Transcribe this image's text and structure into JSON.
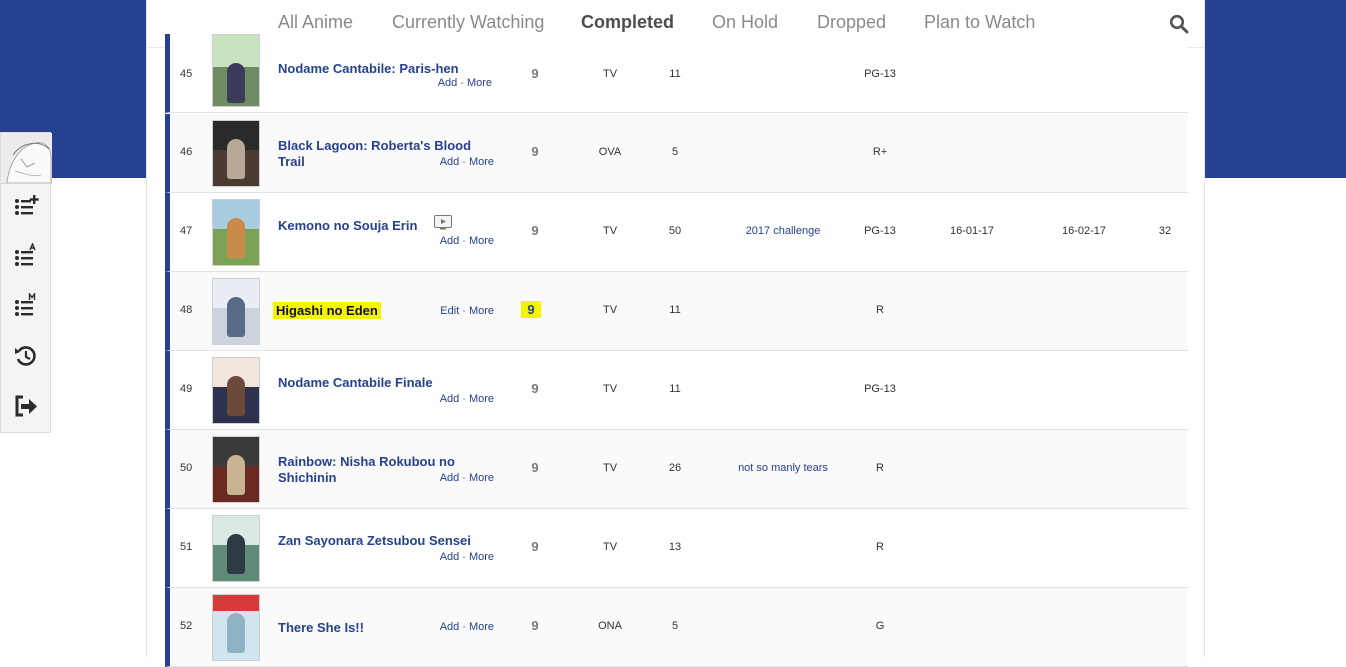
{
  "tabs": [
    {
      "label": "All Anime"
    },
    {
      "label": "Currently Watching"
    },
    {
      "label": "Completed",
      "active": true
    },
    {
      "label": "On Hold"
    },
    {
      "label": "Dropped"
    },
    {
      "label": "Plan to Watch"
    }
  ],
  "icons": {
    "search": "search-icon",
    "sidebar": [
      "add-list-icon",
      "list-anime-icon",
      "list-manga-icon",
      "history-icon",
      "logout-icon"
    ]
  },
  "colors": {
    "accent": "#26418f",
    "highlight": "#f5f500"
  },
  "rows": [
    {
      "num": "45",
      "title": "Nodame Cantabile: Paris-hen",
      "action": "Add",
      "more": "More",
      "score": "9",
      "type": "TV",
      "eps": "11",
      "tags": "",
      "rating": "PG-13",
      "start": "",
      "finish": "",
      "days": ""
    },
    {
      "num": "46",
      "title": "Black Lagoon: Roberta's Blood Trail",
      "action": "Add",
      "more": "More",
      "score": "9",
      "type": "OVA",
      "eps": "5",
      "tags": "",
      "rating": "R+",
      "start": "",
      "finish": "",
      "days": ""
    },
    {
      "num": "47",
      "title": "Kemono no Souja Erin",
      "action": "Add",
      "more": "More",
      "score": "9",
      "type": "TV",
      "eps": "50",
      "tags": "2017 challenge",
      "rating": "PG-13",
      "start": "16-01-17",
      "finish": "16-02-17",
      "days": "32"
    },
    {
      "num": "48",
      "title": "Higashi no Eden",
      "action": "Edit",
      "more": "More",
      "score": "9",
      "type": "TV",
      "eps": "11",
      "tags": "",
      "rating": "R",
      "start": "",
      "finish": "",
      "days": ""
    },
    {
      "num": "49",
      "title": "Nodame Cantabile Finale",
      "action": "Add",
      "more": "More",
      "score": "9",
      "type": "TV",
      "eps": "11",
      "tags": "",
      "rating": "PG-13",
      "start": "",
      "finish": "",
      "days": ""
    },
    {
      "num": "50",
      "title": "Rainbow: Nisha Rokubou no Shichinin",
      "action": "Add",
      "more": "More",
      "score": "9",
      "type": "TV",
      "eps": "26",
      "tags": "not so manly tears",
      "rating": "R",
      "start": "",
      "finish": "",
      "days": ""
    },
    {
      "num": "51",
      "title": "Zan Sayonara Zetsubou Sensei",
      "action": "Add",
      "more": "More",
      "score": "9",
      "type": "TV",
      "eps": "13",
      "tags": "",
      "rating": "R",
      "start": "",
      "finish": "",
      "days": ""
    },
    {
      "num": "52",
      "title": "There She Is!!",
      "action": "Add",
      "more": "More",
      "score": "9",
      "type": "ONA",
      "eps": "5",
      "tags": "",
      "rating": "G",
      "start": "",
      "finish": "",
      "days": ""
    }
  ]
}
